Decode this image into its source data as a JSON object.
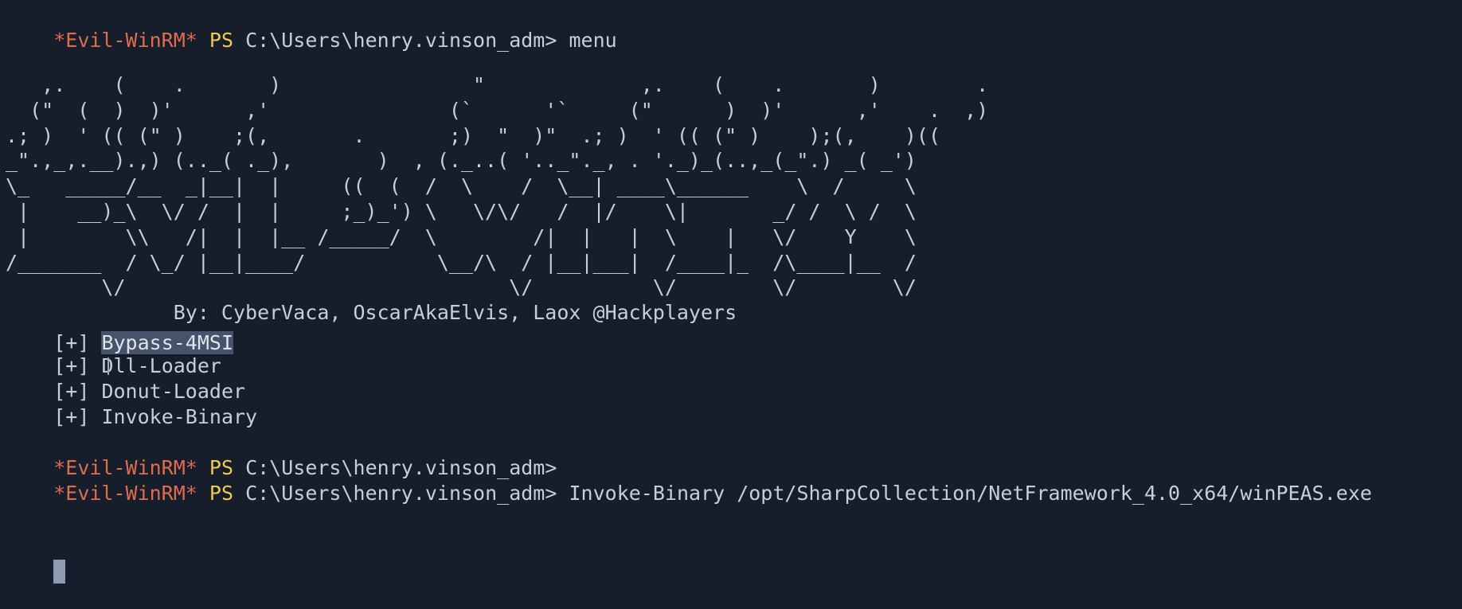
{
  "terminal": {
    "prompt": {
      "evil": "*Evil-WinRM*",
      "ps": "PS",
      "path": "C:\\Users\\henry.vinson_adm>"
    },
    "first_command": "menu",
    "banner_lines": [
      "   ,.    (    .       )                \"             ,.    (    .       )        .",
      "  (\"  (  )  )'      ,'               (`      '`     (\"      )  )'      ,'    .  ,)",
      ".; )  ' (( (\" )    ;(,       .       ;)  \"  )\"  .; )  ' (( (\" )    );(,    )((",
      "_\".,_,.__).,) (.._( ._),       )  , (._..( '.._\"._, . '._)_(..,_(_\".) _( _')",
      "\\_   _____/__  _|__|  |     ((  (  /  \\    /  \\__| ____\\______    \\  /     \\",
      " |    __)_\\  \\/ /  |  |     ;_)_') \\   \\/\\/   /  |/    \\|       _/ /  \\ /  \\",
      " |        \\\\   /|  |  |__ /_____/  \\        /|  |   |  \\    |   \\/    Y    \\",
      "/_______  / \\_/ |__|____/           \\__/\\  / |__|___|  /____|_  /\\____|__  /",
      "        \\/                                \\/          \\/        \\/        \\/",
      "              By: CyberVaca, OscarAkaElvis, Laox @Hackplayers"
    ],
    "menu_items": [
      {
        "prefix": "[+] ",
        "label": "Bypass-4MSI"
      },
      {
        "prefix": "[+] ",
        "label": "Dll-Loader"
      },
      {
        "prefix": "[+] ",
        "label": "Donut-Loader"
      },
      {
        "prefix": "[+] ",
        "label": "Invoke-Binary"
      }
    ],
    "second_command": "",
    "third_command": "Invoke-Binary /opt/SharpCollection/NetFramework_4.0_x64/winPEAS.exe"
  },
  "colors": {
    "background": "#161e2c",
    "text": "#c9ced6",
    "prompt_evil": "#e06c4f",
    "prompt_ps": "#f2c94c",
    "selection": "#46536b",
    "cursor": "#8d9ab0"
  },
  "icons": {
    "cursor": "block-cursor-icon",
    "mouse_pointer": "i-beam-cursor-icon"
  }
}
